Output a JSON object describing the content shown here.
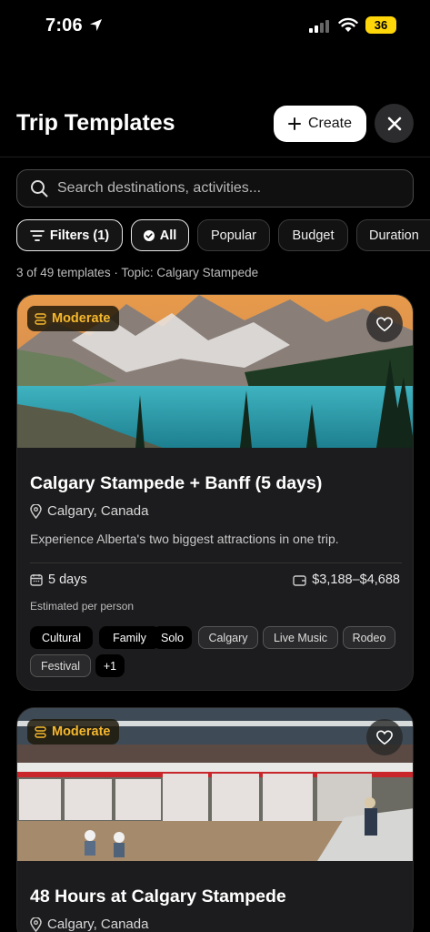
{
  "status_bar": {
    "time": "7:06",
    "battery": "36"
  },
  "header": {
    "title": "Trip Templates",
    "create_label": "Create"
  },
  "search": {
    "placeholder": "Search destinations, activities..."
  },
  "filters": {
    "filters_label": "Filters (1)",
    "chips": [
      "All",
      "Popular",
      "Budget",
      "Duration"
    ],
    "active_chip": "All"
  },
  "results": {
    "summary": "3 of 49 templates · Topic: Calgary Stampede"
  },
  "cards": [
    {
      "difficulty": "Moderate",
      "title": "Calgary Stampede + Banff (5 days)",
      "location": "Calgary, Canada",
      "description": "Experience Alberta's two biggest attractions in one trip.",
      "duration": "5 days",
      "price": "$3,188–$4,688",
      "price_note": "Estimated per person",
      "tags": [
        "Cultural",
        "Family",
        "Solo",
        "Calgary",
        "Live Music",
        "Rodeo",
        "Festival",
        "+1"
      ]
    },
    {
      "difficulty": "Moderate",
      "title": "48 Hours at Calgary Stampede",
      "location": "Calgary, Canada"
    }
  ],
  "colors": {
    "badge_text": "#f5b82e",
    "battery": "#ffd60a",
    "background": "#000000",
    "card": "#1c1c1e"
  }
}
